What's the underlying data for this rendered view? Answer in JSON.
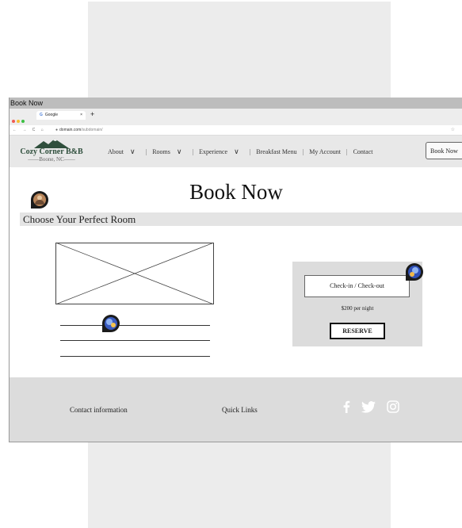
{
  "window": {
    "title": "Book Now"
  },
  "browser": {
    "tab_icon": "G",
    "tab_title": "Google",
    "tab_close": "×",
    "new_tab": "+",
    "nav_controls": "← → C ⌂",
    "url_domain": "domain.com",
    "url_path": "/subdomain/",
    "star": "☆"
  },
  "site": {
    "logo_name": "Cozy Corner B&B",
    "logo_place": "——Boone, NC——"
  },
  "nav": {
    "items": [
      {
        "label": "About",
        "dropdown": true
      },
      {
        "label": "Rooms",
        "dropdown": true
      },
      {
        "label": "Experience",
        "dropdown": true
      },
      {
        "label": "Breakfast Menu",
        "dropdown": false
      },
      {
        "label": "My Account",
        "dropdown": false
      },
      {
        "label": "Contact",
        "dropdown": false
      }
    ],
    "chevron": "∨",
    "separator": "|",
    "book_button": "Book Now"
  },
  "main": {
    "title": "Book Now",
    "section_heading": "Choose Your Perfect Room"
  },
  "booking": {
    "checkin_label": "Check-in / Check-out",
    "price": "$200 per night",
    "reserve_label": "RESERVE"
  },
  "footer": {
    "contact": "Contact information",
    "quick_links": "Quick Links",
    "social_icons": [
      "facebook-icon",
      "twitter-icon",
      "instagram-icon"
    ]
  },
  "colors": {
    "background_panel": "#ececec",
    "navbar": "#e8e8e8",
    "footer": "#dcdcdc",
    "logo_green": "#2f4f3c"
  }
}
